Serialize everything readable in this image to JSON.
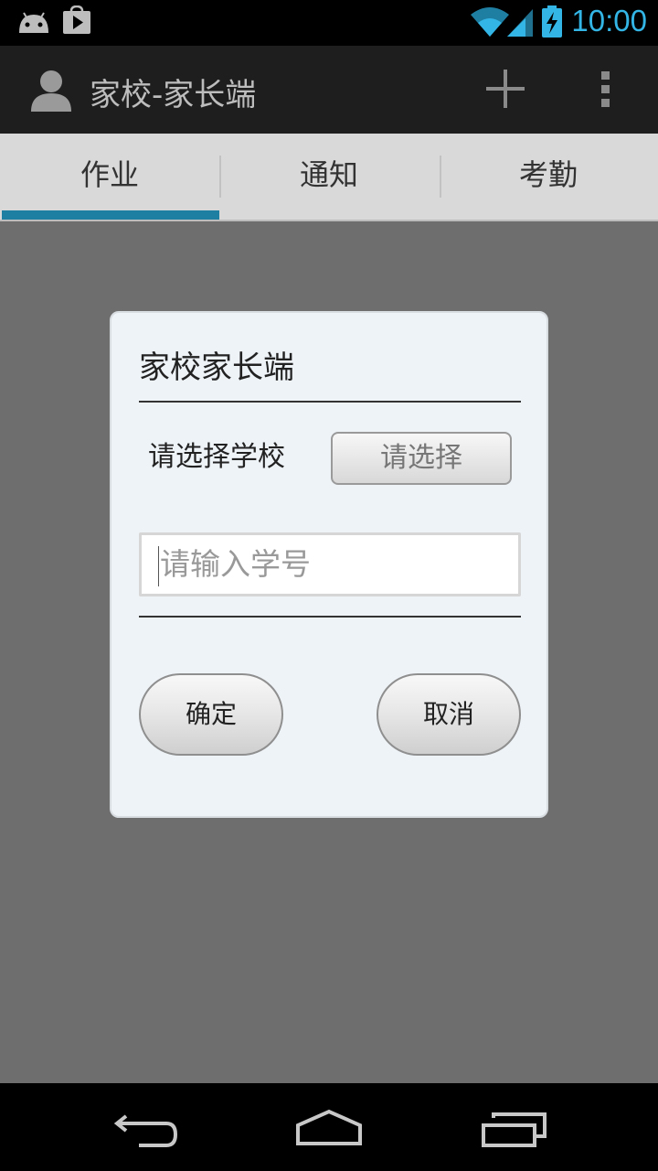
{
  "status_bar": {
    "time": "10:00",
    "icons": [
      "android-icon",
      "play-store-icon",
      "wifi-icon",
      "signal-icon",
      "battery-charging-icon"
    ]
  },
  "action_bar": {
    "title": "家校-家长端",
    "icons": [
      "avatar-icon",
      "add-icon",
      "overflow-menu-icon"
    ]
  },
  "tabs": [
    {
      "label": "作业",
      "selected": true
    },
    {
      "label": "通知",
      "selected": false
    },
    {
      "label": "考勤",
      "selected": false
    }
  ],
  "dialog": {
    "title": "家校家长端",
    "school_label": "请选择学校",
    "school_button": "请选择",
    "student_id_placeholder": "请输入学号",
    "confirm_button": "确定",
    "cancel_button": "取消"
  },
  "nav_bar": {
    "icons": [
      "back-icon",
      "home-icon",
      "recents-icon"
    ]
  },
  "colors": {
    "accent": "#33b5e5",
    "tab_indicator": "#1f7fa3",
    "action_bar": "#1e1e1e",
    "overlay": "#6e6e6e"
  }
}
